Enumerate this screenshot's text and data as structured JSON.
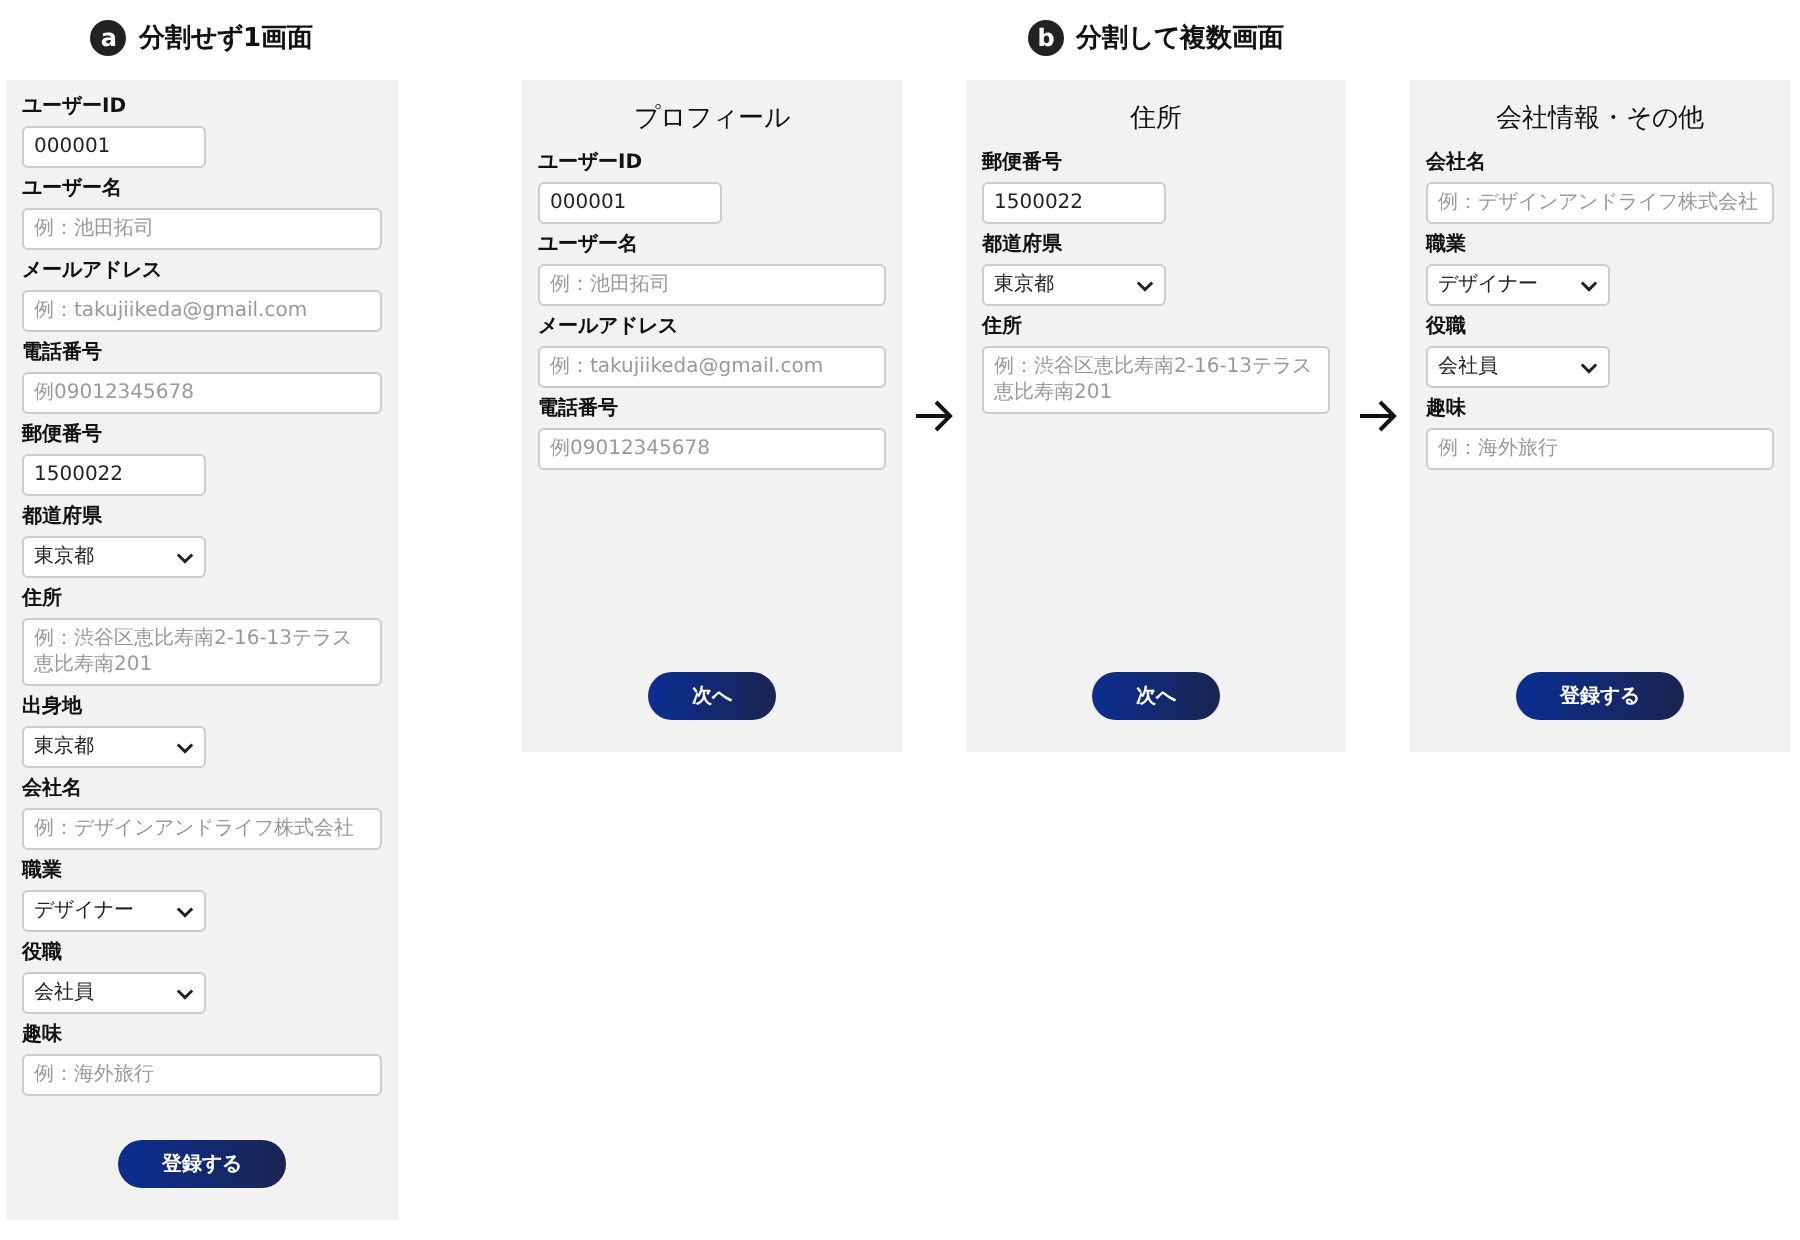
{
  "sections": [
    {
      "badge": "a",
      "title": "分割せず1画面",
      "screens": [
        {
          "fields": [
            {
              "label": "ユーザーID",
              "kind": "input",
              "value": "000001"
            },
            {
              "label": "ユーザー名",
              "kind": "input",
              "placeholder": "例：池田拓司"
            },
            {
              "label": "メールアドレス",
              "kind": "input",
              "placeholder": "例：takujiikeda@gmail.com"
            },
            {
              "label": "電話番号",
              "kind": "input",
              "placeholder": "例09012345678"
            },
            {
              "label": "郵便番号",
              "kind": "input",
              "value": "1500022"
            },
            {
              "label": "都道府県",
              "kind": "select",
              "value": "東京都"
            },
            {
              "label": "住所",
              "kind": "input",
              "placeholder": "例：渋谷区恵比寿南2-16-13テラス恵比寿南201"
            },
            {
              "label": "出身地",
              "kind": "select",
              "value": "東京都"
            },
            {
              "label": "会社名",
              "kind": "input",
              "placeholder": "例：デザインアンドライフ株式会社"
            },
            {
              "label": "職業",
              "kind": "select",
              "value": "デザイナー"
            },
            {
              "label": "役職",
              "kind": "select",
              "value": "会社員"
            },
            {
              "label": "趣味",
              "kind": "input",
              "placeholder": "例：海外旅行"
            }
          ],
          "button": "登録する"
        }
      ]
    },
    {
      "badge": "b",
      "title": "分割して複数画面",
      "screens": [
        {
          "title": "プロフィール",
          "fields": [
            {
              "label": "ユーザーID",
              "kind": "input",
              "value": "000001"
            },
            {
              "label": "ユーザー名",
              "kind": "input",
              "placeholder": "例：池田拓司"
            },
            {
              "label": "メールアドレス",
              "kind": "input",
              "placeholder": "例：takujiikeda@gmail.com"
            },
            {
              "label": "電話番号",
              "kind": "input",
              "placeholder": "例09012345678"
            }
          ],
          "button": "次へ"
        },
        {
          "title": "住所",
          "fields": [
            {
              "label": "郵便番号",
              "kind": "input",
              "value": "1500022"
            },
            {
              "label": "都道府県",
              "kind": "select",
              "value": "東京都"
            },
            {
              "label": "住所",
              "kind": "input",
              "placeholder": "例：渋谷区恵比寿南2-16-13テラス恵比寿南201"
            }
          ],
          "button": "次へ"
        },
        {
          "title": "会社情報・その他",
          "fields": [
            {
              "label": "会社名",
              "kind": "input",
              "placeholder": "例：デザインアンドライフ株式会社"
            },
            {
              "label": "職業",
              "kind": "select",
              "value": "デザイナー"
            },
            {
              "label": "役職",
              "kind": "select",
              "value": "会社員"
            },
            {
              "label": "趣味",
              "kind": "input",
              "placeholder": "例：海外旅行"
            }
          ],
          "button": "登録する"
        }
      ]
    }
  ]
}
